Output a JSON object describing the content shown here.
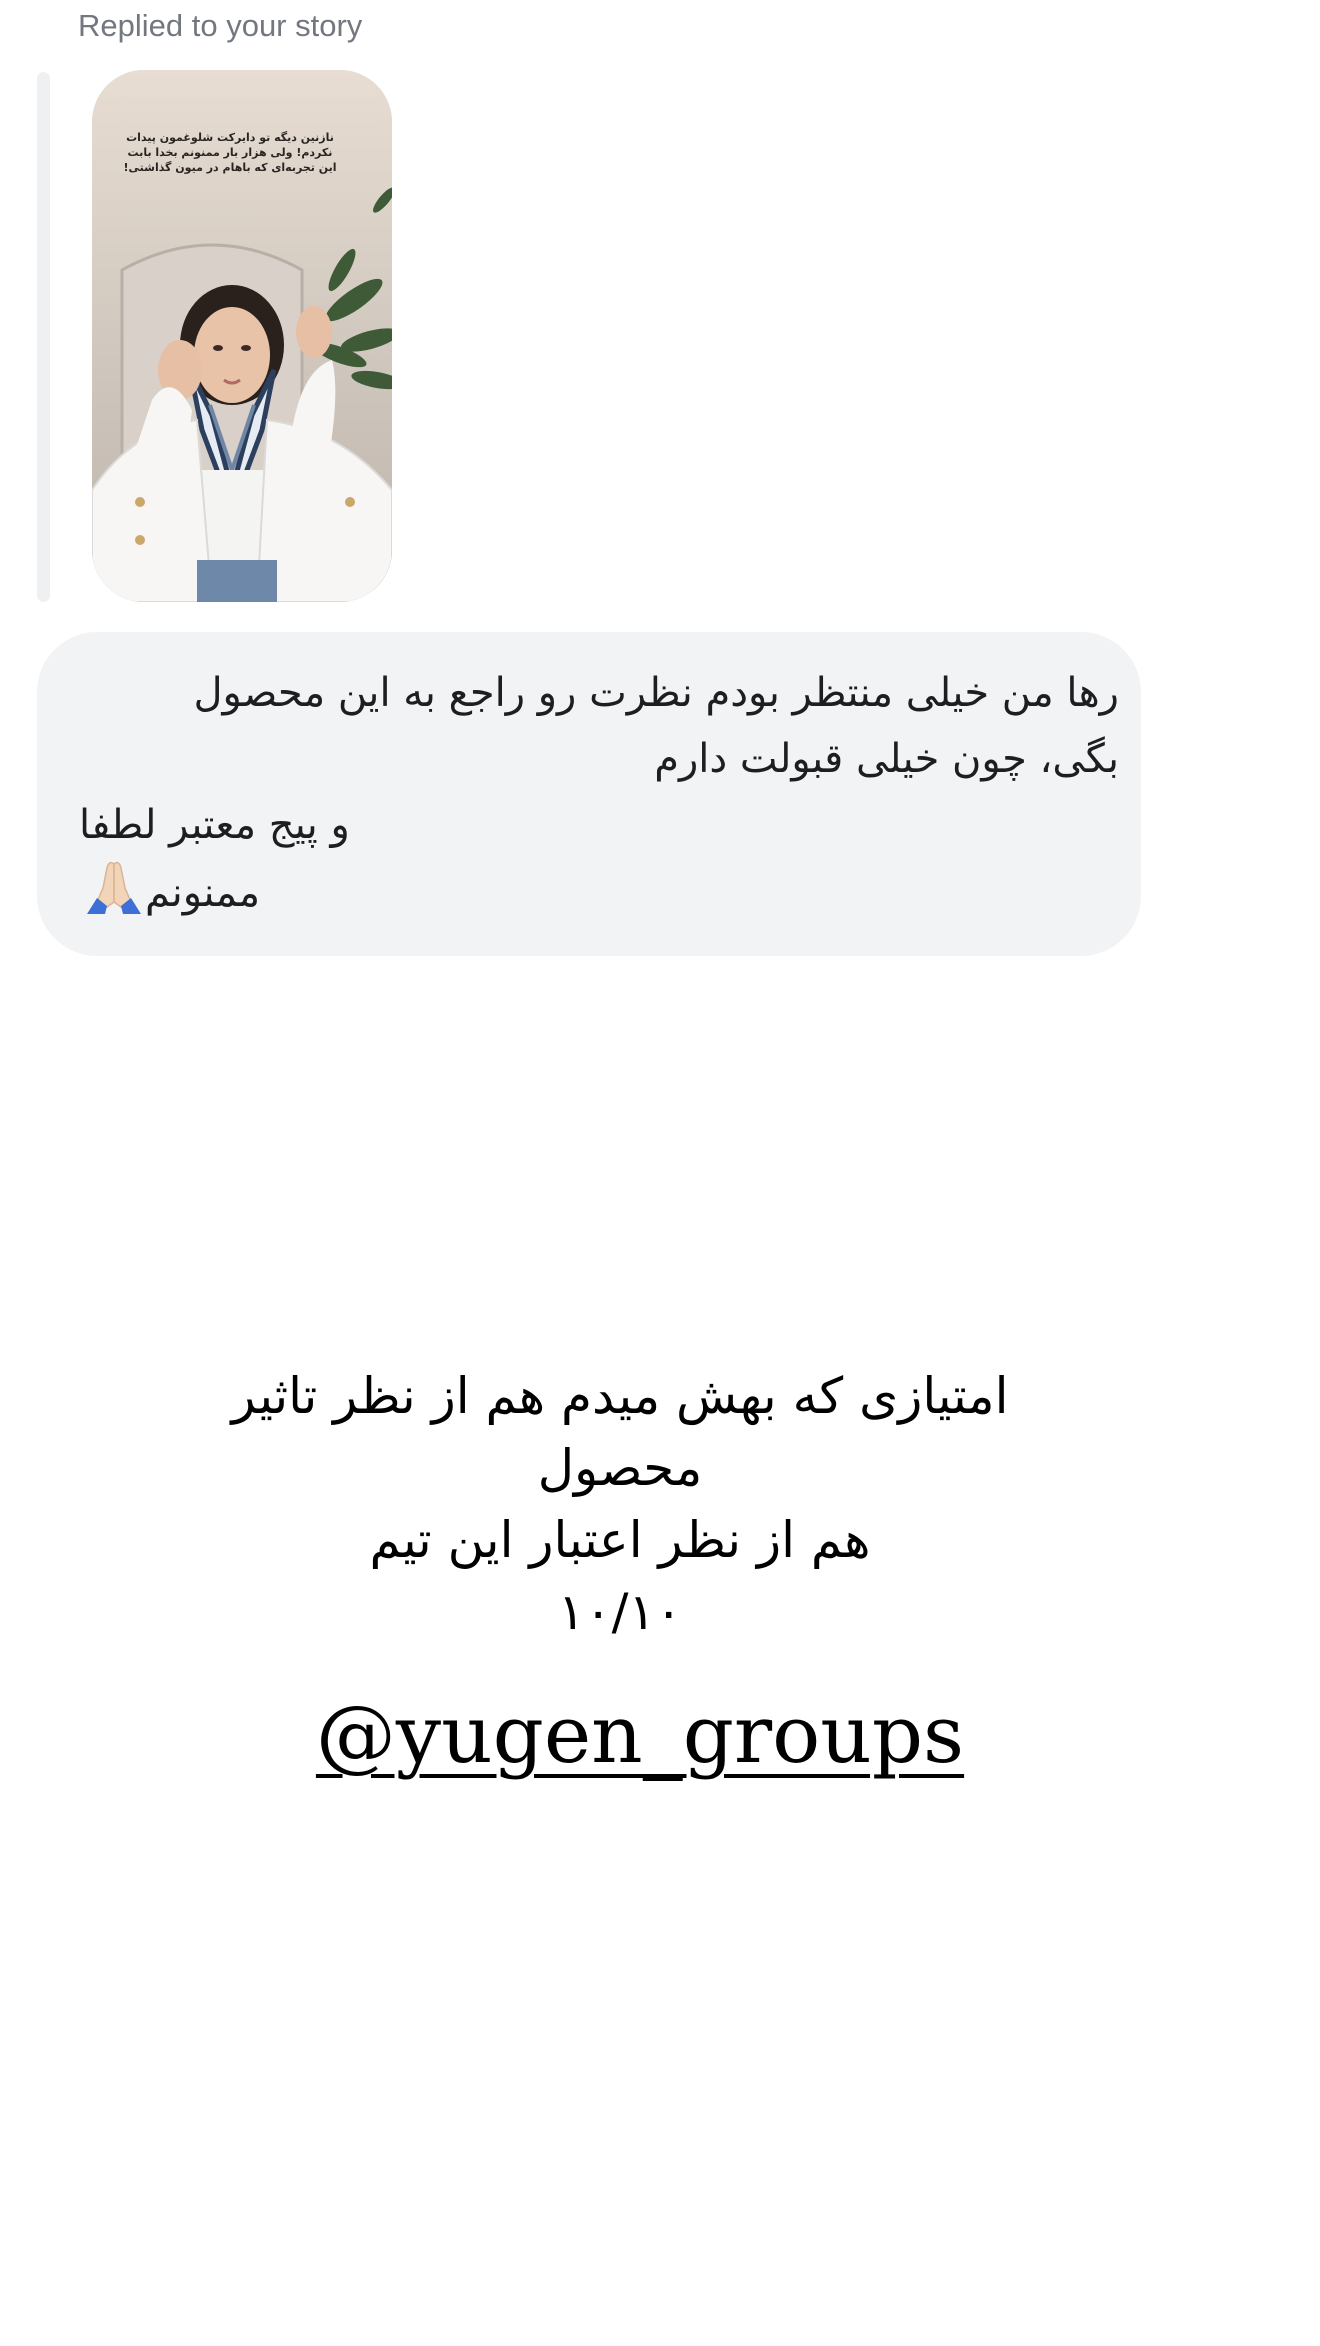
{
  "reply_header": {
    "label": "Replied to your story"
  },
  "story": {
    "caption_lines": [
      "نازنین دیگه تو دایرکت شلوغمون پیدات",
      "نکردم! ولی هزار بار ممنونم بخدا بابت",
      "این تجربه‌ای که باهام در میون گذاشتی!"
    ]
  },
  "message": {
    "lines": [
      "رها من خیلی منتظر بودم نظرت رو راجع به این محصول",
      "بگی، چون خیلی قبولت دارم",
      "و پیج معتبر لطفا",
      "ممنونم"
    ],
    "emoji": "🙏🏻"
  },
  "caption": {
    "lines": [
      "امتیازی که بهش میدم هم از نظر تاثیر",
      "محصول",
      "هم از نظر اعتبار این تیم",
      "۱۰/۱۰"
    ]
  },
  "handle": {
    "text": "@yugen_groups"
  },
  "colors": {
    "bubble_background": "#f2f3f5",
    "reply_bar": "#eef0f2",
    "muted_label": "#737880",
    "text": "#1c1e21"
  }
}
